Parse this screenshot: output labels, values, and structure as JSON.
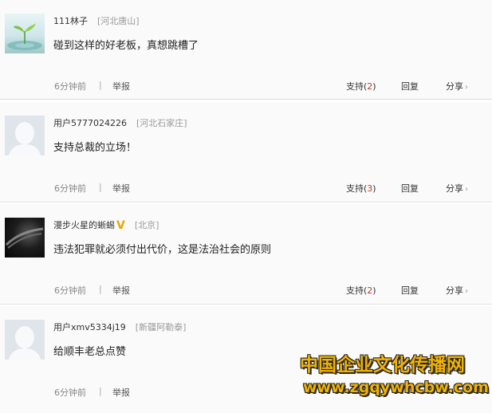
{
  "comments": [
    {
      "username": "111林子",
      "location": "[河北唐山]",
      "content": "碰到这样的好老板，真想跳槽了",
      "time": "6分钟前",
      "separator": "|",
      "report": "举报",
      "support_label": "支持(",
      "support_count": "2",
      "support_close": ")",
      "reply": "回复",
      "share": "分享",
      "share_arrow": "›",
      "avatar": "plant-avatar"
    },
    {
      "username": "用户5777024226",
      "location": "[河北石家庄]",
      "content": "支持总裁的立场！",
      "time": "6分钟前",
      "separator": "|",
      "report": "举报",
      "support_label": "支持(",
      "support_count": "3",
      "support_close": ")",
      "reply": "回复",
      "share": "分享",
      "share_arrow": "›",
      "avatar": "default-avatar"
    },
    {
      "username": "漫步火星的蜥蜴",
      "vip_badge": "V",
      "location": "[北京]",
      "content": "违法犯罪就必须付出代价，这是法治社会的原则",
      "time": "6分钟前",
      "separator": "|",
      "report": "举报",
      "support_label": "支持(",
      "support_count": "2",
      "support_close": ")",
      "reply": "回复",
      "share": "分享",
      "share_arrow": "›",
      "avatar": "dark-avatar"
    },
    {
      "username": "用户xmv5334j19",
      "location": "[新疆阿勒泰]",
      "content": "给顺丰老总点赞",
      "time": "6分钟前",
      "separator": "|",
      "report": "举报",
      "avatar": "default-avatar"
    }
  ],
  "watermark": {
    "title": "中国企业文化传播网",
    "url": "www.zgqywhcbw.com"
  },
  "colors": {
    "support_count": "#c0392b",
    "vip_badge": "#e8a400",
    "watermark": "#f2b200"
  }
}
